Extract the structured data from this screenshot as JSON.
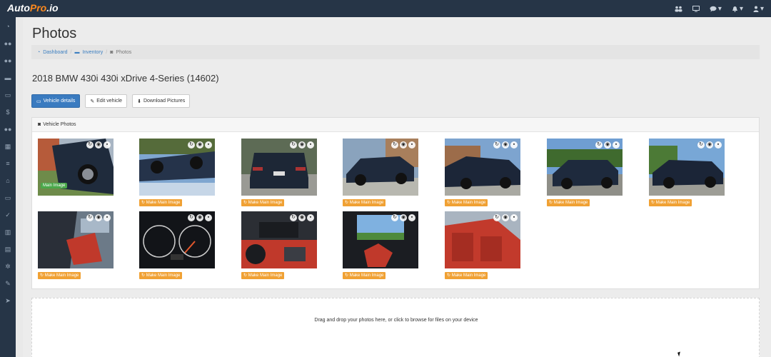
{
  "app": {
    "logo_main": "Auto",
    "logo_accent": "Pro",
    "logo_suffix": ".io"
  },
  "topbar": {
    "icons": [
      "users-icon",
      "monitor-icon",
      "chat-icon",
      "bell-icon",
      "user-icon"
    ]
  },
  "sidebar": {
    "icons": [
      "dashboard-icon",
      "customers-icon",
      "contacts-icon",
      "car-icon",
      "id-card-icon",
      "dollar-icon",
      "team-icon",
      "calendar-icon",
      "list-icon",
      "bank-icon",
      "money-icon",
      "thumbs-up-icon",
      "chart-icon",
      "bar-chart-icon",
      "settings-icon",
      "wrench-icon",
      "send-icon"
    ]
  },
  "page": {
    "title": "Photos"
  },
  "breadcrumb": {
    "dashboard": "Dashboard",
    "inventory": "Inventory",
    "current": "Photos"
  },
  "vehicle": {
    "title": "2018 BMW 430i 430i xDrive 4-Series (14602)"
  },
  "buttons": {
    "vehicle_details": "Vehicle details",
    "edit_vehicle": "Edit vehicle",
    "download_pictures": "Download Pictures"
  },
  "panel": {
    "title": "Vehicle Photos"
  },
  "photos": {
    "main_badge": "Main Image",
    "make_main_label": "Make Main Image",
    "items": [
      {
        "label": "car-side-dark",
        "is_main": true
      },
      {
        "label": "car-rotated",
        "is_main": false
      },
      {
        "label": "car-rear",
        "is_main": false
      },
      {
        "label": "car-front-three-quarter",
        "is_main": false
      },
      {
        "label": "car-front-angle",
        "is_main": false
      },
      {
        "label": "car-street-view",
        "is_main": false
      },
      {
        "label": "car-side-profile",
        "is_main": false
      },
      {
        "label": "interior-door",
        "is_main": false
      },
      {
        "label": "instrument-cluster",
        "is_main": false
      },
      {
        "label": "interior-dashboard",
        "is_main": false
      },
      {
        "label": "sunroof-view",
        "is_main": false
      },
      {
        "label": "rear-seats",
        "is_main": false
      }
    ]
  },
  "dropzone": {
    "text": "Drag and drop your photos here, or click to browse for files on your device"
  },
  "colors": {
    "topbar": "#263547",
    "primary_button": "#3a7bc0",
    "make_main_button": "#f0a134",
    "main_badge": "#4aa84a",
    "brand_accent": "#ff8a1e"
  }
}
